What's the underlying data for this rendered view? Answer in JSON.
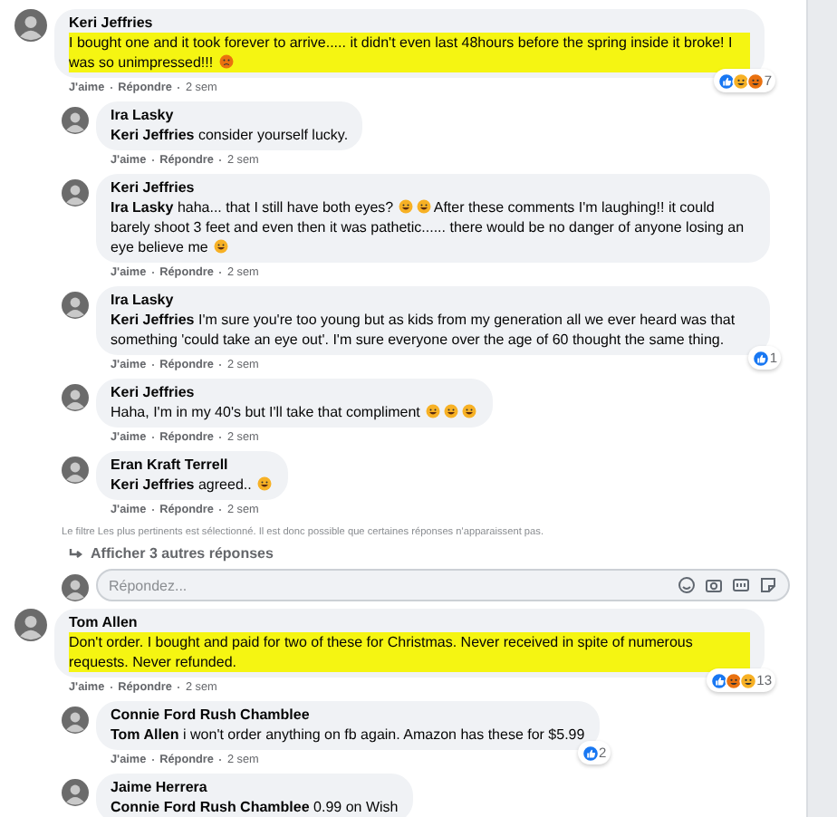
{
  "comments": [
    {
      "author": "Keri Jeffries",
      "highlighted": true,
      "body": [
        {
          "kind": "text",
          "text": "I bought one and it took forever to arrive..... it didn't even last 48hours before the spring inside it broke! I was so unimpressed!!!"
        },
        {
          "kind": "angry_emoji"
        }
      ],
      "actions": [
        "J'aime",
        "Répondre",
        "2 sem"
      ],
      "reactions": {
        "icons": [
          {
            "kind": "like"
          },
          {
            "kind": "laugh"
          },
          {
            "kind": "angry"
          }
        ],
        "count": "7"
      },
      "thread": [
        {
          "kind": "reply",
          "author": "Ira Lasky",
          "body": [
            {
              "kind": "mention",
              "text": "Keri Jeffries"
            },
            {
              "kind": "text",
              "text": "consider yourself lucky."
            }
          ],
          "actions": [
            "J'aime",
            "Répondre",
            "2 sem"
          ]
        },
        {
          "kind": "reply",
          "author": "Keri Jeffries",
          "body": [
            {
              "kind": "mention",
              "text": "Ira Lasky"
            },
            {
              "kind": "text",
              "text": "haha... that I still have both eyes?"
            },
            {
              "kind": "laugh_emoji"
            },
            {
              "kind": "laugh_emoji"
            },
            {
              "kind": "text",
              "text": "After these comments I'm laughing!! it could barely shoot 3 feet and even then it was pathetic...... there would be no danger of anyone losing an eye believe me"
            },
            {
              "kind": "laugh_emoji"
            }
          ],
          "actions": [
            "J'aime",
            "Répondre",
            "2 sem"
          ]
        },
        {
          "kind": "reply",
          "author": "Ira Lasky",
          "body": [
            {
              "kind": "mention",
              "text": "Keri Jeffries"
            },
            {
              "kind": "text",
              "text": "I'm sure you're too young but as kids from my generation all we ever heard was that something 'could take an eye out'. I'm sure everyone over the age of 60 thought the same thing."
            }
          ],
          "actions": [
            "J'aime",
            "Répondre",
            "2 sem"
          ],
          "reactions": {
            "icons": [
              {
                "kind": "like"
              }
            ],
            "count": "1"
          }
        },
        {
          "kind": "reply",
          "author": "Keri Jeffries",
          "body": [
            {
              "kind": "text",
              "text": "Haha, I'm in my 40's but I'll take that compliment"
            },
            {
              "kind": "laugh_emoji"
            },
            {
              "kind": "laugh_emoji"
            },
            {
              "kind": "laugh_emoji"
            }
          ],
          "actions": [
            "J'aime",
            "Répondre",
            "2 sem"
          ]
        },
        {
          "kind": "reply",
          "author": "Eran Kraft Terrell",
          "body": [
            {
              "kind": "mention",
              "text": "Keri Jeffries"
            },
            {
              "kind": "text",
              "text": "agreed.."
            },
            {
              "kind": "grin_emoji"
            }
          ],
          "actions": [
            "J'aime",
            "Répondre",
            "2 sem"
          ]
        },
        {
          "kind": "notice",
          "text": "Le filtre Les plus pertinents est sélectionné. Il est donc possible que certaines réponses n'apparaissent pas."
        },
        {
          "kind": "more",
          "text": "Afficher 3 autres réponses"
        },
        {
          "kind": "composer",
          "placeholder": "Répondez..."
        }
      ]
    },
    {
      "author": "Tom Allen",
      "highlighted": true,
      "body": [
        {
          "kind": "text",
          "text": "Don't order. I bought and paid for two of these for Christmas. Never received in spite of numerous requests. Never refunded."
        }
      ],
      "actions": [
        "J'aime",
        "Répondre",
        "2 sem"
      ],
      "reactions": {
        "icons": [
          {
            "kind": "like"
          },
          {
            "kind": "angry"
          },
          {
            "kind": "laugh"
          }
        ],
        "count": "13"
      },
      "thread": [
        {
          "kind": "reply",
          "author": "Connie Ford Rush Chamblee",
          "body": [
            {
              "kind": "mention",
              "text": "Tom Allen"
            },
            {
              "kind": "text",
              "text": "i won't order anything on fb again. Amazon has these for $5.99"
            }
          ],
          "actions": [
            "J'aime",
            "Répondre",
            "2 sem"
          ],
          "reactions": {
            "icons": [
              {
                "kind": "like"
              }
            ],
            "count": "2"
          }
        },
        {
          "kind": "reply",
          "author": "Jaime Herrera",
          "body": [
            {
              "kind": "mention",
              "text": "Connie Ford Rush Chamblee"
            },
            {
              "kind": "text",
              "text": "0.99 on Wish"
            }
          ]
        }
      ]
    }
  ]
}
